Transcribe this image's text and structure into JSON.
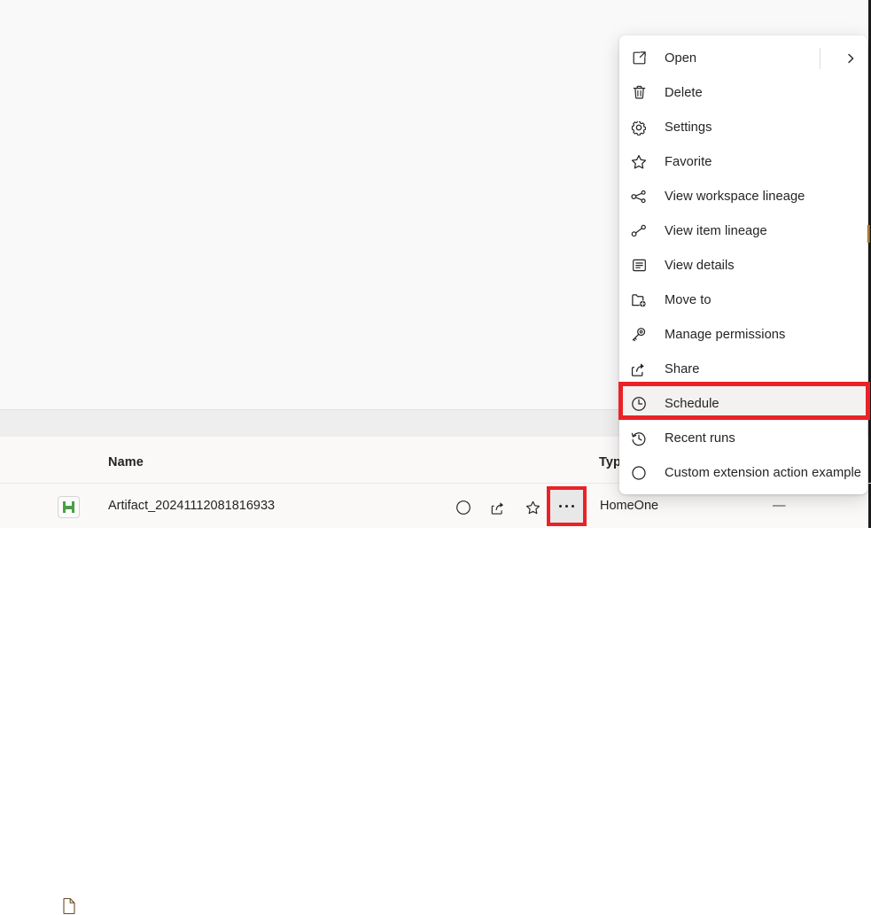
{
  "window": {
    "background_color": "#faf9f8",
    "content_background_color": "#f9f9f9",
    "toolbar_band_color": "#efeeee"
  },
  "list": {
    "columns": [
      {
        "key": "icon",
        "label": "",
        "icon": "document-icon"
      },
      {
        "key": "name",
        "label": "Name"
      },
      {
        "key": "type",
        "label": "Typ"
      }
    ],
    "rows": [
      {
        "type_icon": "artifact-green-icon",
        "name": "Artifact_20241112081816933",
        "workspace": "HomeOne",
        "refreshed": "—",
        "actions": [
          {
            "name": "endorsement-icon",
            "glyph": "circle"
          },
          {
            "name": "share-icon",
            "glyph": "share"
          },
          {
            "name": "favorite-icon",
            "glyph": "star"
          },
          {
            "name": "more-options-button",
            "glyph": "ellipsis",
            "highlighted": true
          }
        ]
      }
    ]
  },
  "context_menu": {
    "highlight_color": "#ea2227",
    "highlighted_item": "Schedule",
    "items": [
      {
        "icon": "open-external-icon",
        "label": "Open",
        "has_submenu": true
      },
      {
        "icon": "trash-icon",
        "label": "Delete",
        "has_submenu": false
      },
      {
        "icon": "gear-icon",
        "label": "Settings",
        "has_submenu": false
      },
      {
        "icon": "star-icon",
        "label": "Favorite",
        "has_submenu": false
      },
      {
        "icon": "workspace-lineage-icon",
        "label": "View workspace lineage",
        "has_submenu": false
      },
      {
        "icon": "item-lineage-icon",
        "label": "View item lineage",
        "has_submenu": false
      },
      {
        "icon": "details-icon",
        "label": "View details",
        "has_submenu": false
      },
      {
        "icon": "move-to-folder-icon",
        "label": "Move to",
        "has_submenu": false
      },
      {
        "icon": "key-icon",
        "label": "Manage permissions",
        "has_submenu": false
      },
      {
        "icon": "share-icon",
        "label": "Share",
        "has_submenu": false
      },
      {
        "icon": "clock-icon",
        "label": "Schedule",
        "has_submenu": false
      },
      {
        "icon": "history-icon",
        "label": "Recent runs",
        "has_submenu": false
      },
      {
        "icon": "circle-icon",
        "label": "Custom extension action example",
        "has_submenu": false
      }
    ]
  }
}
